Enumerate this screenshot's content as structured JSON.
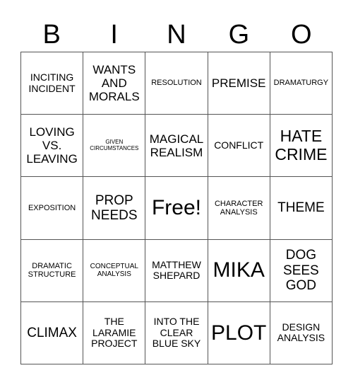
{
  "header": {
    "letters": [
      "B",
      "I",
      "N",
      "G",
      "O"
    ]
  },
  "cells": [
    [
      "INCITING INCIDENT",
      "WANTS AND MORALS",
      "RESOLUTION",
      "PREMISE",
      "DRAMATURGY"
    ],
    [
      "LOVING VS. LEAVING",
      "GIVEN CIRCUMSTANCES",
      "MAGICAL REALISM",
      "CONFLICT",
      "HATE CRIME"
    ],
    [
      "EXPOSITION",
      "PROP NEEDS",
      "Free!",
      "CHARACTER ANALYSIS",
      "THEME"
    ],
    [
      "DRAMATIC STRUCTURE",
      "CONCEPTUAL ANALYSIS",
      "MATTHEW SHEPARD",
      "MIKA",
      "DOG SEES GOD"
    ],
    [
      "CLIMAX",
      "THE LARAMIE PROJECT",
      "INTO THE CLEAR BLUE SKY",
      "PLOT",
      "DESIGN ANALYSIS"
    ]
  ]
}
